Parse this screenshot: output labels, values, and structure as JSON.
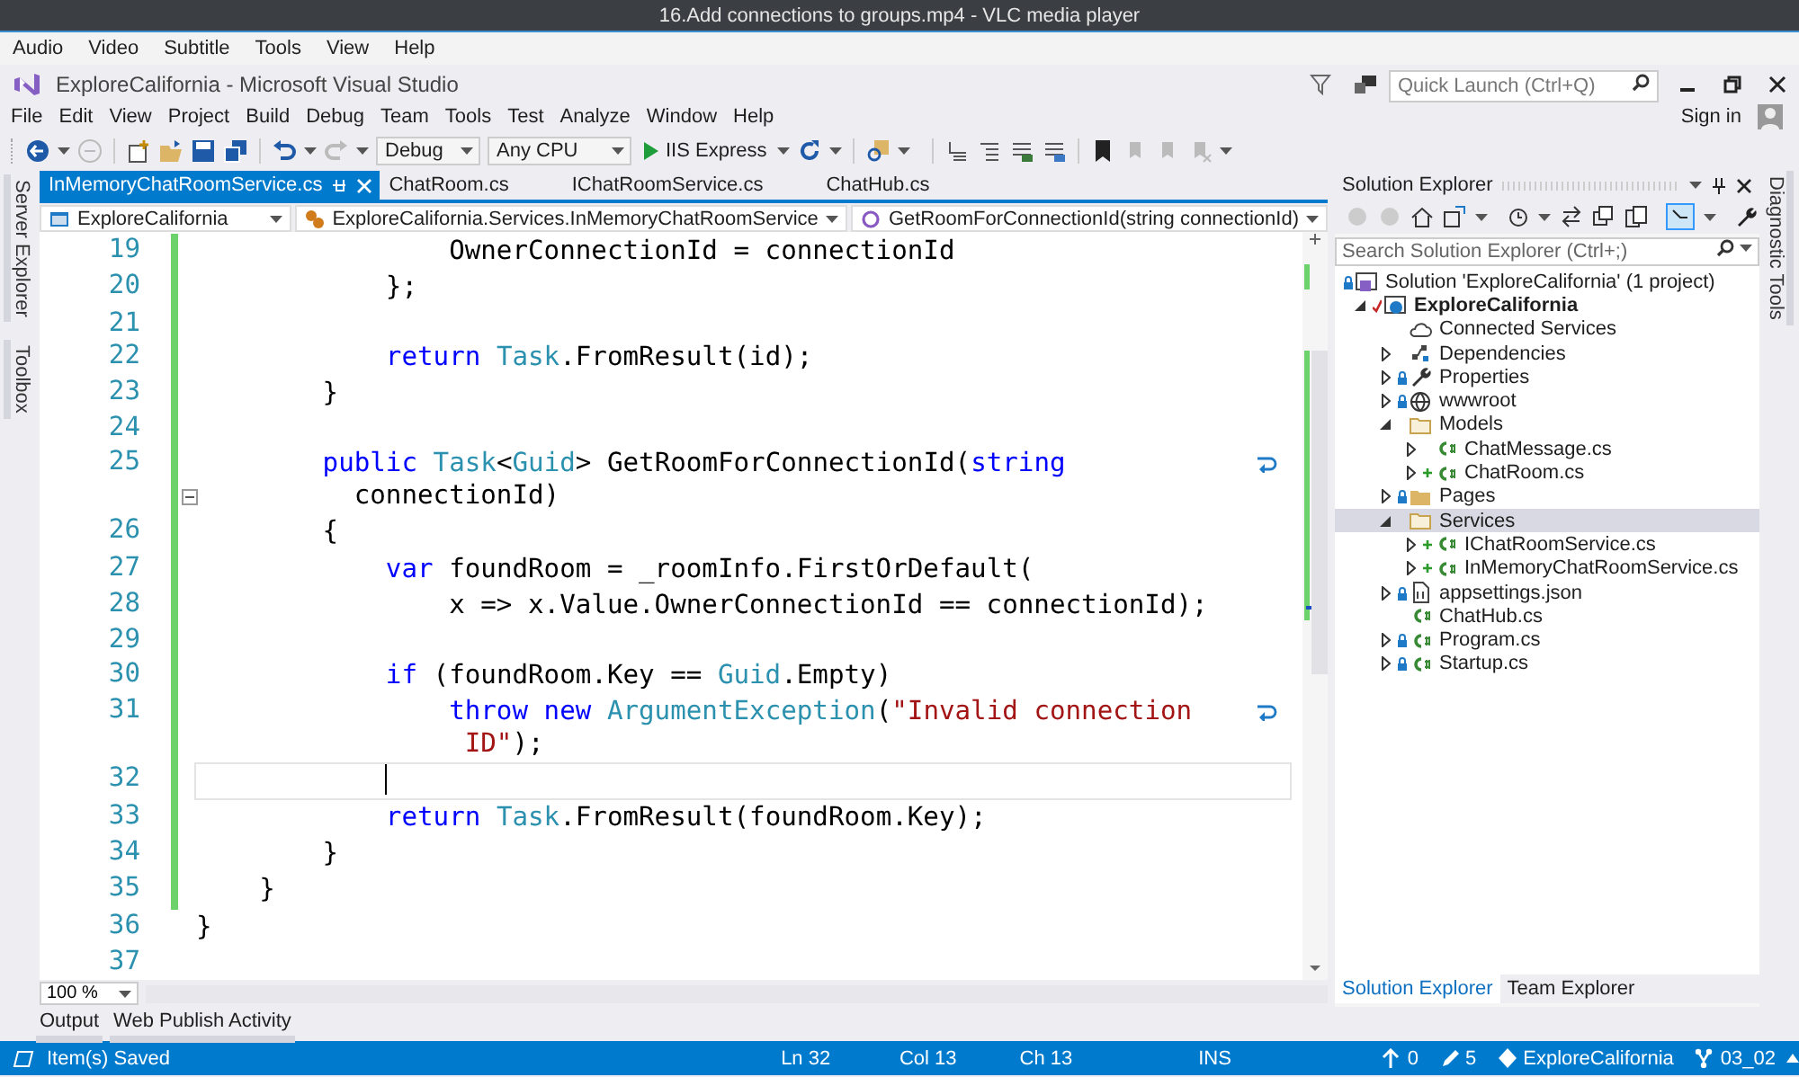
{
  "player": {
    "title": "16.Add connections to groups.mp4 - VLC media player",
    "menu": [
      "Audio",
      "Video",
      "Subtitle",
      "Tools",
      "View",
      "Help"
    ]
  },
  "ide": {
    "title": "ExploreCalifornia - Microsoft Visual Studio",
    "quick_launch": {
      "placeholder": "Quick Launch (Ctrl+Q)"
    },
    "menu": [
      "File",
      "Edit",
      "View",
      "Project",
      "Build",
      "Debug",
      "Team",
      "Tools",
      "Test",
      "Analyze",
      "Window",
      "Help"
    ],
    "sign_in": "Sign in",
    "toolbar": {
      "configuration": "Debug",
      "platform": "Any CPU",
      "run": "IIS Express"
    }
  },
  "left_tabs": [
    "Server Explorer",
    "Toolbox"
  ],
  "right_tabs": [
    "Diagnostic Tools"
  ],
  "editor": {
    "tabs": [
      {
        "label": "InMemoryChatRoomService.cs",
        "selected": true
      },
      {
        "label": "ChatRoom.cs",
        "selected": false
      },
      {
        "label": "IChatRoomService.cs",
        "selected": false
      },
      {
        "label": "ChatHub.cs",
        "selected": false
      }
    ],
    "nav": [
      "ExploreCalifornia",
      "ExploreCalifornia.Services.InMemoryChatRoomService",
      "GetRoomForConnectionId(string connectionId)"
    ],
    "lines": [
      {
        "number": "19",
        "changed": true,
        "current": false,
        "fold": false,
        "tokens": [
          {
            "kind": "plain",
            "text": "                OwnerConnectionId = connectionId"
          }
        ]
      },
      {
        "number": "20",
        "changed": true,
        "current": false,
        "fold": false,
        "tokens": [
          {
            "kind": "plain",
            "text": "            };"
          }
        ]
      },
      {
        "number": "21",
        "changed": true,
        "current": false,
        "fold": false
      },
      {
        "number": "22",
        "changed": true,
        "current": false,
        "fold": false,
        "tokens": [
          {
            "kind": "keyword",
            "text": "            return "
          },
          {
            "kind": "type",
            "text": "Task"
          },
          {
            "kind": "plain",
            "text": ".FromResult(id);"
          }
        ]
      },
      {
        "number": "23",
        "changed": true,
        "current": false,
        "fold": false,
        "tokens": [
          {
            "kind": "plain",
            "text": "        }"
          }
        ]
      },
      {
        "number": "24",
        "changed": true,
        "current": false,
        "fold": false
      },
      {
        "number": "25",
        "changed": true,
        "current": false,
        "fold": true,
        "tokens": [
          {
            "kind": "keyword",
            "text": "        public "
          },
          {
            "kind": "type",
            "text": "Task"
          },
          {
            "kind": "plain",
            "text": "<"
          },
          {
            "kind": "type",
            "text": "Guid"
          },
          {
            "kind": "plain",
            "text": "> GetRoomForConnectionId("
          },
          {
            "kind": "keyword",
            "text": "string"
          }
        ],
        "wrap": [
          {
            "kind": "plain",
            "text": "          connectionId)"
          }
        ]
      },
      {
        "number": "26",
        "changed": true,
        "current": false,
        "fold": false,
        "tokens": [
          {
            "kind": "plain",
            "text": "        {"
          }
        ]
      },
      {
        "number": "27",
        "changed": true,
        "current": false,
        "fold": false,
        "tokens": [
          {
            "kind": "keyword",
            "text": "            var"
          },
          {
            "kind": "plain",
            "text": " foundRoom = _roomInfo.FirstOrDefault("
          }
        ]
      },
      {
        "number": "28",
        "changed": true,
        "current": false,
        "fold": false,
        "tokens": [
          {
            "kind": "plain",
            "text": "                x => x.Value.OwnerConnectionId == connectionId);"
          }
        ]
      },
      {
        "number": "29",
        "changed": true,
        "current": false,
        "fold": false
      },
      {
        "number": "30",
        "changed": true,
        "current": false,
        "fold": false,
        "tokens": [
          {
            "kind": "keyword",
            "text": "            if"
          },
          {
            "kind": "plain",
            "text": " (foundRoom.Key == "
          },
          {
            "kind": "type",
            "text": "Guid"
          },
          {
            "kind": "plain",
            "text": ".Empty)"
          }
        ]
      },
      {
        "number": "31",
        "changed": true,
        "current": false,
        "fold": false,
        "tokens": [
          {
            "kind": "keyword",
            "text": "                throw new "
          },
          {
            "kind": "type",
            "text": "ArgumentException"
          },
          {
            "kind": "plain",
            "text": "("
          },
          {
            "kind": "string",
            "text": "\"Invalid connection"
          }
        ],
        "wrap": [
          {
            "kind": "string",
            "text": "                 ID\""
          },
          {
            "kind": "plain",
            "text": ");"
          }
        ]
      },
      {
        "number": "32",
        "changed": true,
        "current": true,
        "fold": false
      },
      {
        "number": "33",
        "changed": true,
        "current": false,
        "fold": false,
        "tokens": [
          {
            "kind": "keyword",
            "text": "            return "
          },
          {
            "kind": "type",
            "text": "Task"
          },
          {
            "kind": "plain",
            "text": ".FromResult(foundRoom.Key);"
          }
        ]
      },
      {
        "number": "34",
        "changed": true,
        "current": false,
        "fold": false,
        "tokens": [
          {
            "kind": "plain",
            "text": "        }"
          }
        ]
      },
      {
        "number": "35",
        "changed": true,
        "current": false,
        "fold": false,
        "tokens": [
          {
            "kind": "plain",
            "text": "    }"
          }
        ]
      },
      {
        "number": "36",
        "changed": false,
        "current": false,
        "fold": false,
        "tokens": [
          {
            "kind": "plain",
            "text": "}"
          }
        ]
      },
      {
        "number": "37",
        "changed": false,
        "current": false,
        "fold": false
      }
    ],
    "zoom": "100 %"
  },
  "solution_explorer": {
    "title": "Solution Explorer",
    "search": {
      "placeholder": "Search Solution Explorer (Ctrl+;)"
    },
    "tree": [
      {
        "label": "Solution 'ExploreCalifornia' (1 project)",
        "kind": "solution",
        "locked": true,
        "added": false,
        "modified": false,
        "selected": false,
        "children": [
          {
            "label": "ExploreCalifornia",
            "kind": "project",
            "locked": false,
            "added": false,
            "modified": true,
            "expanded": true,
            "selected": false,
            "children": [
              {
                "label": "Connected Services",
                "kind": "service",
                "locked": false,
                "added": false,
                "modified": false,
                "selected": false
              },
              {
                "label": "Dependencies",
                "kind": "dependencies",
                "locked": false,
                "added": false,
                "modified": false,
                "expanded": false,
                "selected": false
              },
              {
                "label": "Properties",
                "kind": "properties",
                "locked": true,
                "added": false,
                "modified": false,
                "expanded": false,
                "selected": false
              },
              {
                "label": "wwwroot",
                "kind": "web",
                "locked": true,
                "added": false,
                "modified": false,
                "expanded": false,
                "selected": false
              },
              {
                "label": "Models",
                "kind": "folder",
                "locked": false,
                "added": false,
                "modified": false,
                "expanded": true,
                "selected": false,
                "children": [
                  {
                    "label": "ChatMessage.cs",
                    "kind": "code",
                    "locked": false,
                    "added": false,
                    "modified": false,
                    "expanded": false,
                    "selected": false
                  },
                  {
                    "label": "ChatRoom.cs",
                    "kind": "code",
                    "locked": false,
                    "added": true,
                    "modified": false,
                    "expanded": false,
                    "selected": false
                  }
                ]
              },
              {
                "label": "Pages",
                "kind": "folder",
                "locked": true,
                "added": false,
                "modified": false,
                "expanded": false,
                "selected": false
              },
              {
                "label": "Services",
                "kind": "folder",
                "locked": false,
                "added": false,
                "modified": false,
                "expanded": true,
                "selected": true,
                "children": [
                  {
                    "label": "IChatRoomService.cs",
                    "kind": "code",
                    "locked": false,
                    "added": true,
                    "modified": false,
                    "expanded": false,
                    "selected": false
                  },
                  {
                    "label": "InMemoryChatRoomService.cs",
                    "kind": "code",
                    "locked": false,
                    "added": true,
                    "modified": false,
                    "expanded": false,
                    "selected": false
                  }
                ]
              },
              {
                "label": "appsettings.json",
                "kind": "config",
                "locked": true,
                "added": false,
                "modified": false,
                "expanded": false,
                "selected": false
              },
              {
                "label": "ChatHub.cs",
                "kind": "code",
                "locked": false,
                "added": false,
                "modified": false,
                "selected": false
              },
              {
                "label": "Program.cs",
                "kind": "code",
                "locked": true,
                "added": false,
                "modified": false,
                "expanded": false,
                "selected": false
              },
              {
                "label": "Startup.cs",
                "kind": "code",
                "locked": true,
                "added": false,
                "modified": false,
                "expanded": false,
                "selected": false
              }
            ]
          }
        ]
      }
    ],
    "tabs": [
      {
        "label": "Solution Explorer",
        "selected": true
      },
      {
        "label": "Team Explorer",
        "selected": false
      }
    ]
  },
  "bottom_tabs": [
    "Output",
    "Web Publish Activity"
  ],
  "status_bar": {
    "message": "Item(s) Saved",
    "line": "Ln 32",
    "column": "Col 13",
    "char": "Ch 13",
    "mode": "INS",
    "unpushed": "0",
    "changes": "5",
    "repository": "ExploreCalifornia",
    "branch": "03_02"
  }
}
